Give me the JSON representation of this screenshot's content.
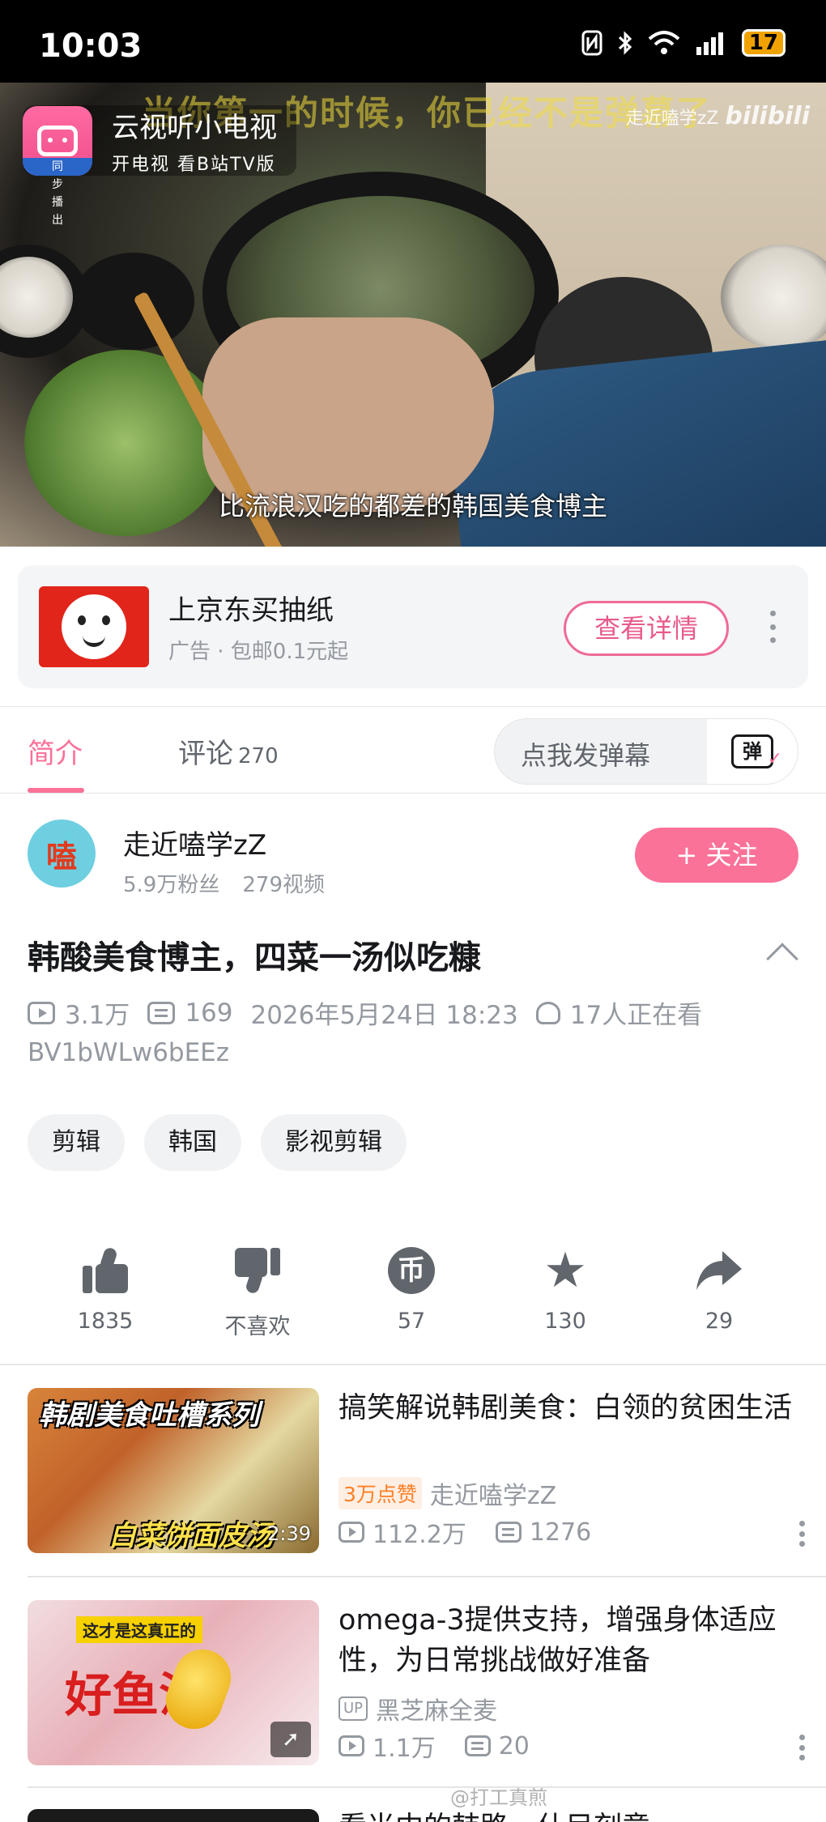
{
  "status_bar": {
    "time": "10:03",
    "battery": "17",
    "icons": [
      "nfc-icon",
      "bluetooth-icon",
      "wifi-icon",
      "signal-icon",
      "battery-icon"
    ]
  },
  "player": {
    "danmaku_text": "当你第一的时候，你已经不是弹幕了",
    "watermark_uploader": "走近嗑学zZ",
    "watermark_logo": "bilibili",
    "subtitle": "比流浪汉吃的都差的韩国美食博主",
    "tv_badge": {
      "title": "云视听小电视",
      "subtitle": "开电视 看B站TV版",
      "tag": "同步播出"
    }
  },
  "ad": {
    "title": "上京东买抽纸",
    "subtitle": "广告 · 包邮0.1元起",
    "button": "查看详情"
  },
  "tabs": {
    "intro": "简介",
    "comments": "评论",
    "comments_count": "270",
    "danmaku_placeholder": "点我发弹幕",
    "danmaku_icon_text": "弹"
  },
  "uploader": {
    "avatar_text": "嗑",
    "name": "走近嗑学zZ",
    "followers": "5.9万粉丝",
    "videos": "279视频",
    "follow_button": "+ 关注"
  },
  "video": {
    "title": "韩酸美食博主，四菜一汤似吃糠",
    "views": "3.1万",
    "danmaku_count": "169",
    "date": "2026年5月24日 18:23",
    "watching": "17人正在看",
    "bvid": "BV1bWLw6bEEz",
    "tags": [
      "剪辑",
      "韩国",
      "影视剪辑"
    ]
  },
  "actions": [
    {
      "icon": "thumb-up-icon",
      "label": "1835"
    },
    {
      "icon": "thumb-down-icon",
      "label": "不喜欢"
    },
    {
      "icon": "coin-icon",
      "label": "57",
      "glyph": "币"
    },
    {
      "icon": "star-icon",
      "label": "130"
    },
    {
      "icon": "share-icon",
      "label": "29"
    }
  ],
  "recommendations": [
    {
      "thumb_top": "韩剧美食吐槽系列",
      "thumb_bottom": "白菜饼面皮汤",
      "duration": "2:39",
      "title": "搞笑解说韩剧美食：白领的贫困生活",
      "badge": "3万点赞",
      "author": "走近嗑学zZ",
      "views": "112.2万",
      "danmaku": "1276"
    },
    {
      "thumb_top": "这才是这真正的",
      "thumb_main": "好鱼油",
      "title": "omega-3提供支持，增强身体适应性，为日常挑战做好准备",
      "badge": "UP",
      "author": "黑芝麻全麦",
      "views": "1.1万",
      "danmaku": "20"
    }
  ],
  "partial_next_title": "看当中的韩路，什目刻意",
  "footer_watermark": "@打工真煎"
}
